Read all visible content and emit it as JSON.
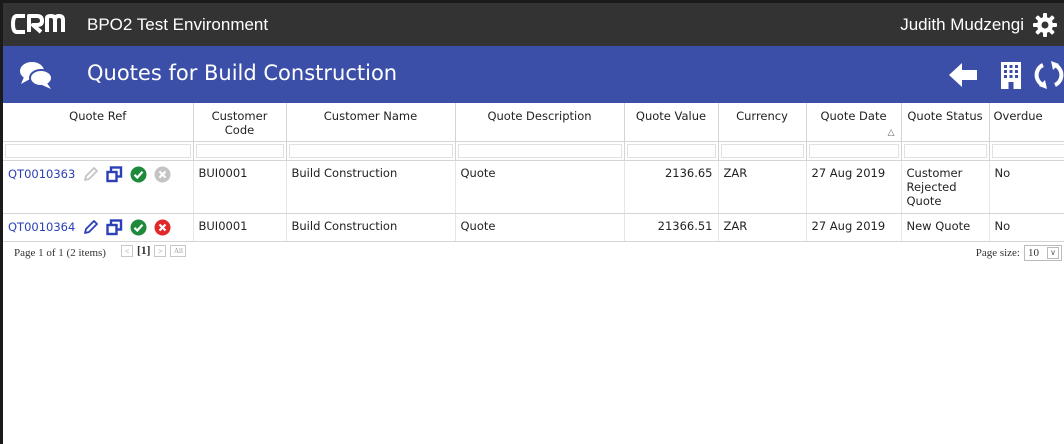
{
  "app": {
    "logo_text": "CRM",
    "title": "BPO2 Test Environment",
    "user_name": "Judith Mudzengi"
  },
  "page": {
    "title": "Quotes for Build Construction"
  },
  "grid": {
    "columns": [
      {
        "key": "ref",
        "label": "Quote Ref"
      },
      {
        "key": "code",
        "label": "Customer Code"
      },
      {
        "key": "name",
        "label": "Customer Name"
      },
      {
        "key": "desc",
        "label": "Quote Description"
      },
      {
        "key": "value",
        "label": "Quote Value"
      },
      {
        "key": "currency",
        "label": "Currency"
      },
      {
        "key": "date",
        "label": "Quote Date"
      },
      {
        "key": "status",
        "label": "Quote Status"
      },
      {
        "key": "overdue",
        "label": "Overdue"
      }
    ],
    "rows": [
      {
        "ref": "QT0010363",
        "code": "BUI0001",
        "name": "Build Construction",
        "desc": "Quote",
        "value": "2136.65",
        "currency": "ZAR",
        "date": "27 Aug 2019",
        "status": "Customer Rejected Quote",
        "overdue": "No"
      },
      {
        "ref": "QT0010364",
        "code": "BUI0001",
        "name": "Build Construction",
        "desc": "Quote",
        "value": "21366.51",
        "currency": "ZAR",
        "date": "27 Aug 2019",
        "status": "New Quote",
        "overdue": "No"
      }
    ]
  },
  "pager": {
    "info": "Page 1 of 1 (2 items)",
    "current_page": "[1]",
    "prev_label": "<",
    "next_label": ">",
    "all_label": "All",
    "page_size_label": "Page size:",
    "page_size_value": "10"
  },
  "colors": {
    "topbar": "#333333",
    "titlebar": "#3c4fa8",
    "link": "#2b40b6",
    "approve": "#1f8a3b",
    "reject": "#e02828",
    "disabled": "#c4c4c4"
  }
}
